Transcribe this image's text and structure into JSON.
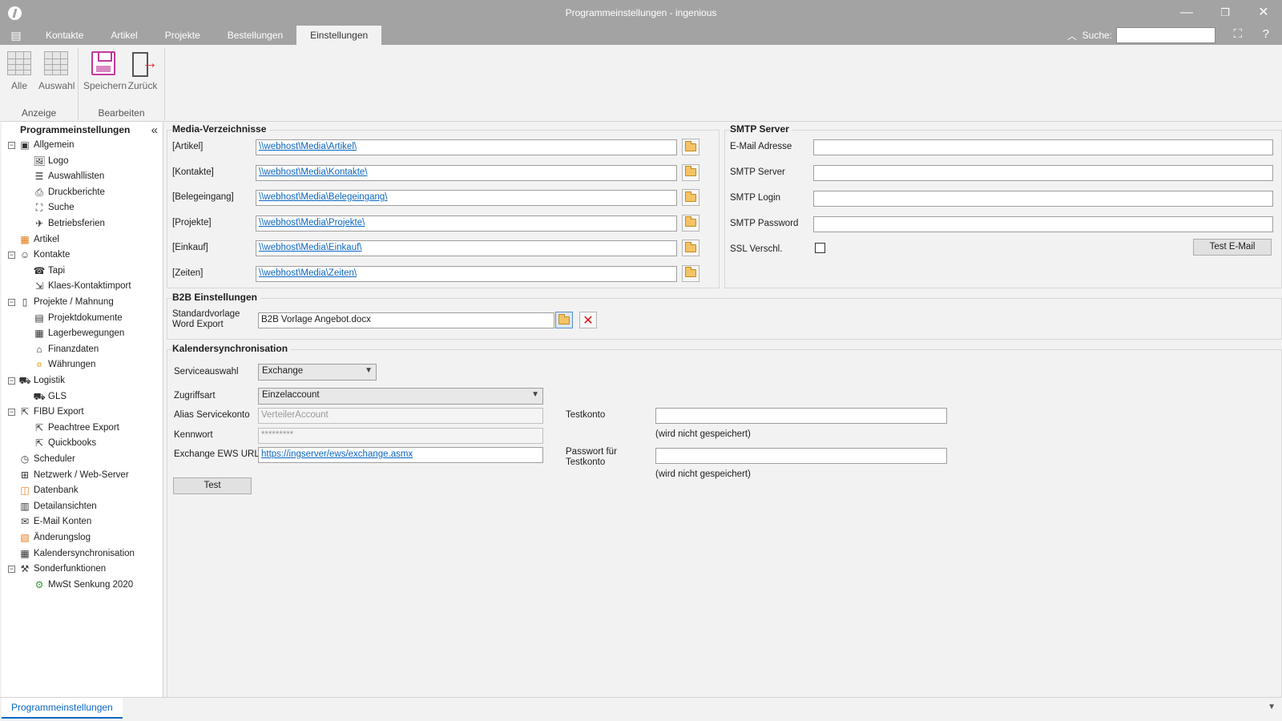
{
  "window": {
    "title": "Programmeinstellungen - ingenious"
  },
  "tabs": [
    "Kontakte",
    "Artikel",
    "Projekte",
    "Bestellungen",
    "Einstellungen"
  ],
  "active_tab": "Einstellungen",
  "search": {
    "label": "Suche:",
    "value": ""
  },
  "ribbon": {
    "groups": [
      {
        "label": "Anzeige",
        "buttons": [
          "Alle",
          "Auswahl"
        ]
      },
      {
        "label": "Bearbeiten",
        "buttons": [
          "Speichern",
          "Zurück"
        ]
      }
    ]
  },
  "tree": {
    "header": "Programmeinstellungen",
    "nodes": [
      {
        "label": "Allgemein",
        "level": 0,
        "expander": "minus",
        "icon": "general-icon"
      },
      {
        "label": "Logo",
        "level": 1,
        "icon": "image-icon"
      },
      {
        "label": "Auswahllisten",
        "level": 1,
        "icon": "list-icon"
      },
      {
        "label": "Druckberichte",
        "level": 1,
        "icon": "printer-icon"
      },
      {
        "label": "Suche",
        "level": 1,
        "icon": "binoculars-icon"
      },
      {
        "label": "Betriebsferien",
        "level": 1,
        "icon": "airplane-icon"
      },
      {
        "label": "Artikel",
        "level": 0,
        "icon": "article-icon"
      },
      {
        "label": "Kontakte",
        "level": 0,
        "expander": "minus",
        "icon": "person-icon"
      },
      {
        "label": "Tapi",
        "level": 1,
        "icon": "phone-icon"
      },
      {
        "label": "Klaes-Kontaktimport",
        "level": 1,
        "icon": "import-icon"
      },
      {
        "label": "Projekte / Mahnung",
        "level": 0,
        "expander": "minus",
        "icon": "document-icon"
      },
      {
        "label": "Projektdokumente",
        "level": 1,
        "icon": "document-list-icon"
      },
      {
        "label": "Lagerbewegungen",
        "level": 1,
        "icon": "table-icon"
      },
      {
        "label": "Finanzdaten",
        "level": 1,
        "icon": "bank-icon"
      },
      {
        "label": "Währungen",
        "level": 1,
        "icon": "currency-icon"
      },
      {
        "label": "Logistik",
        "level": 0,
        "expander": "minus",
        "icon": "truck-icon"
      },
      {
        "label": "GLS",
        "level": 1,
        "icon": "truck-icon"
      },
      {
        "label": "FIBU Export",
        "level": 0,
        "expander": "minus",
        "icon": "export-icon"
      },
      {
        "label": "Peachtree Export",
        "level": 1,
        "icon": "export-icon"
      },
      {
        "label": "Quickbooks",
        "level": 1,
        "icon": "export-icon"
      },
      {
        "label": "Scheduler",
        "level": 0,
        "icon": "clock-icon"
      },
      {
        "label": "Netzwerk / Web-Server",
        "level": 0,
        "icon": "network-icon"
      },
      {
        "label": "Datenbank",
        "level": 0,
        "icon": "database-icon"
      },
      {
        "label": "Detailansichten",
        "level": 0,
        "icon": "detail-view-icon"
      },
      {
        "label": "E-Mail Konten",
        "level": 0,
        "icon": "mail-icon"
      },
      {
        "label": "Änderungslog",
        "level": 0,
        "icon": "log-icon"
      },
      {
        "label": "Kalendersynchronisation",
        "level": 0,
        "icon": "calendar-icon"
      },
      {
        "label": "Sonderfunktionen",
        "level": 0,
        "expander": "minus",
        "icon": "tools-icon"
      },
      {
        "label": "MwSt Senkung 2020",
        "level": 1,
        "icon": "gear-icon"
      }
    ]
  },
  "media": {
    "title": "Media-Verzeichnisse",
    "rows": [
      {
        "label": "[Artikel]",
        "value": "\\\\webhost\\Media\\Artikel\\"
      },
      {
        "label": "[Kontakte]",
        "value": "\\\\webhost\\Media\\Kontakte\\"
      },
      {
        "label": "[Belegeingang]",
        "value": "\\\\webhost\\Media\\Belegeingang\\"
      },
      {
        "label": "[Projekte]",
        "value": "\\\\webhost\\Media\\Projekte\\"
      },
      {
        "label": "[Einkauf]",
        "value": "\\\\webhost\\Media\\Einkauf\\"
      },
      {
        "label": "[Zeiten]",
        "value": "\\\\webhost\\Media\\Zeiten\\"
      }
    ]
  },
  "smtp": {
    "title": "SMTP Server",
    "email_label": "E-Mail Adresse",
    "email_value": "",
    "server_label": "SMTP Server",
    "server_value": "",
    "login_label": "SMTP Login",
    "login_value": "",
    "password_label": "SMTP Password",
    "password_value": "",
    "ssl_label": "SSL Verschl.",
    "ssl_checked": false,
    "test_button": "Test E-Mail"
  },
  "b2b": {
    "title": "B2B Einstellungen",
    "template_label_line1": "Standardvorlage",
    "template_label_line2": "Word Export",
    "template_value": "B2B Vorlage Angebot.docx"
  },
  "calendar": {
    "title": "Kalendersynchronisation",
    "service_label": "Serviceauswahl",
    "service_value": "Exchange",
    "access_label": "Zugriffsart",
    "access_value": "Einzelaccount",
    "alias_label": "Alias Servicekonto",
    "alias_placeholder": "VerteilerAccount",
    "password_label": "Kennwort",
    "password_value": "*********",
    "ews_label": "Exchange EWS URL",
    "ews_value": "https://ingserver/ews/exchange.asmx",
    "test_button": "Test",
    "testaccount_label": "Testkonto",
    "testaccount_value": "",
    "testaccount_note": "(wird nicht gespeichert)",
    "testpassword_label_line1": "Passwort für",
    "testpassword_label_line2": "Testkonto",
    "testpassword_value": "",
    "testpassword_note": "(wird nicht gespeichert)"
  },
  "bottom_tab": "Programmeinstellungen",
  "colors": {
    "titlebar": "#a3a3a3",
    "link": "#0b66c2",
    "save_accent": "#c2399a"
  }
}
